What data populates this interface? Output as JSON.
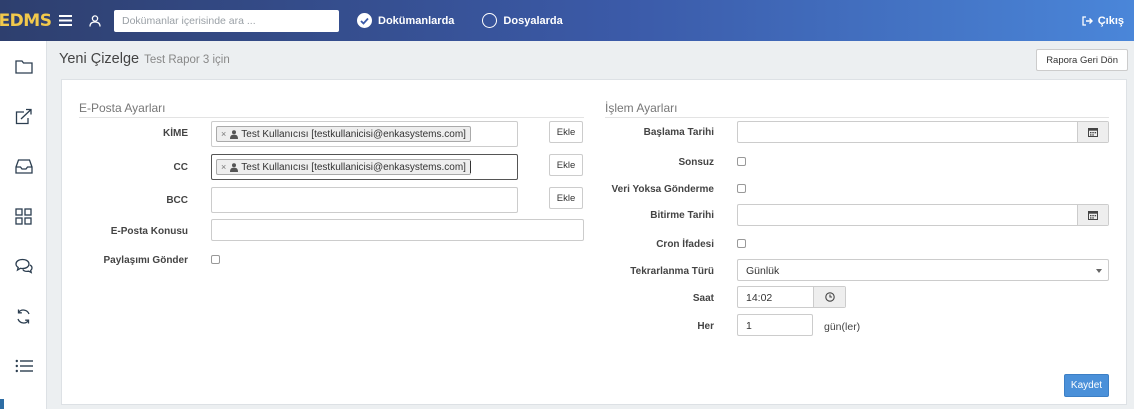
{
  "header": {
    "logo": "EDMS",
    "search_placeholder": "Dokümanlar içerisinde ara ...",
    "search_option_documents": "Dokümanlarda",
    "search_option_folders": "Dosyalarda",
    "logout_label": "Çıkış"
  },
  "page": {
    "title": "Yeni Çizelge",
    "subtitle": "Test Rapor 3 için",
    "back_button": "Rapora Geri Dön"
  },
  "email_settings": {
    "legend": "E-Posta Ayarları",
    "to_label": "KİME",
    "to_recipient": "Test Kullanıcısı [testkullanicisi@enkasystems.com]",
    "cc_label": "CC",
    "cc_recipient": "Test Kullanıcısı [testkullanicisi@enkasystems.com]",
    "bcc_label": "BCC",
    "add_label": "Ekle",
    "subject_label": "E-Posta Konusu",
    "share_label": "Paylaşımı Gönder"
  },
  "process_settings": {
    "legend": "İşlem Ayarları",
    "start_date_label": "Başlama Tarihi",
    "infinite_label": "Sonsuz",
    "no_data_send_label": "Veri Yoksa Gönderme",
    "end_date_label": "Bitirme Tarihi",
    "cron_label": "Cron İfadesi",
    "repeat_type_label": "Tekrarlanma Türü",
    "repeat_type_value": "Günlük",
    "time_label": "Saat",
    "time_value": "14:02",
    "every_label": "Her",
    "every_value": "1",
    "every_unit": "gün(ler)"
  },
  "save_button": "Kaydet"
}
